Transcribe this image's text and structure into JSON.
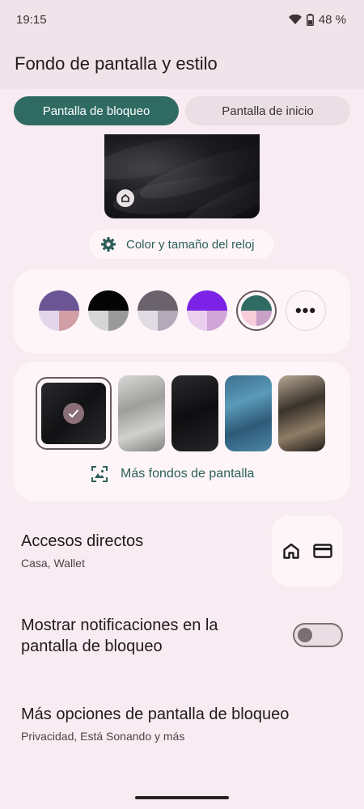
{
  "status_bar": {
    "time": "19:15",
    "battery": "48 %"
  },
  "header": {
    "title": "Fondo de pantalla y estilo"
  },
  "tabs": [
    {
      "label": "Pantalla de bloqueo",
      "active": true
    },
    {
      "label": "Pantalla de inicio",
      "active": false
    }
  ],
  "clock_button": {
    "label": "Color y tamaño del reloj",
    "icon": "gear-icon"
  },
  "color_swatches": [
    {
      "top": "#6b5595",
      "bl": "#e3d6ea",
      "br": "#d29fa6",
      "selected": false
    },
    {
      "top": "#050505",
      "bl": "#d6d6d6",
      "br": "#9a9a9a",
      "selected": false
    },
    {
      "top": "#6b636b",
      "bl": "#e1dce3",
      "br": "#b4a9b8",
      "selected": false
    },
    {
      "top": "#7b22e6",
      "bl": "#ead0ec",
      "br": "#d0a5d8",
      "selected": false
    },
    {
      "top": "#2f6b63",
      "bl": "#f6cdd8",
      "br": "#c9a0c8",
      "selected": true
    }
  ],
  "more_colors_label": "•••",
  "wallpapers": [
    {
      "name": "dark-feathers",
      "selected": true
    },
    {
      "name": "white-feathers",
      "selected": false
    },
    {
      "name": "black-feathers",
      "selected": false
    },
    {
      "name": "blue-feathers",
      "selected": false
    },
    {
      "name": "brown-feathers",
      "selected": false
    }
  ],
  "more_wallpapers": {
    "label": "Más fondos de pantalla"
  },
  "shortcuts": {
    "title": "Accesos directos",
    "subtitle": "Casa, Wallet"
  },
  "notifications": {
    "title": "Mostrar notificaciones en la pantalla de bloqueo",
    "enabled": false
  },
  "more_options": {
    "title": "Más opciones de pantalla de bloqueo",
    "subtitle": "Privacidad, Está Sonando and más"
  }
}
